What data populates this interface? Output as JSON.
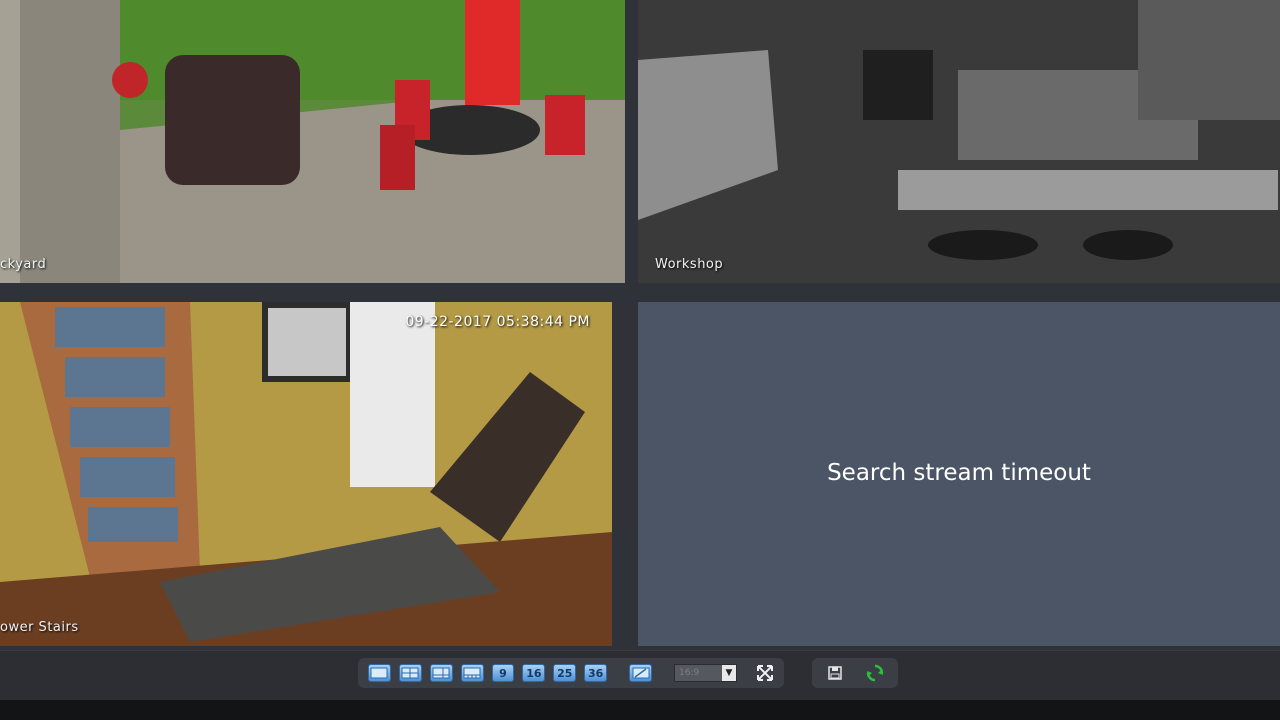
{
  "cameras": [
    {
      "label": "ckyard"
    },
    {
      "label": "Workshop"
    },
    {
      "label": "ower Stairs",
      "timestamp": "09-22-2017 05:38:44 PM"
    },
    {
      "message": "Search stream timeout"
    }
  ],
  "toolbar": {
    "layouts": [
      "",
      "",
      "",
      "",
      "9",
      "16",
      "25",
      "36"
    ],
    "aspect_ratio": "16:9",
    "icons": [
      "layout-1-icon",
      "layout-4-icon",
      "layout-6-icon",
      "layout-8-icon",
      "fullscreen-icon",
      "save-icon",
      "refresh-icon"
    ],
    "accent_color": "#5aa0e6",
    "refresh_color": "#27c23a"
  }
}
